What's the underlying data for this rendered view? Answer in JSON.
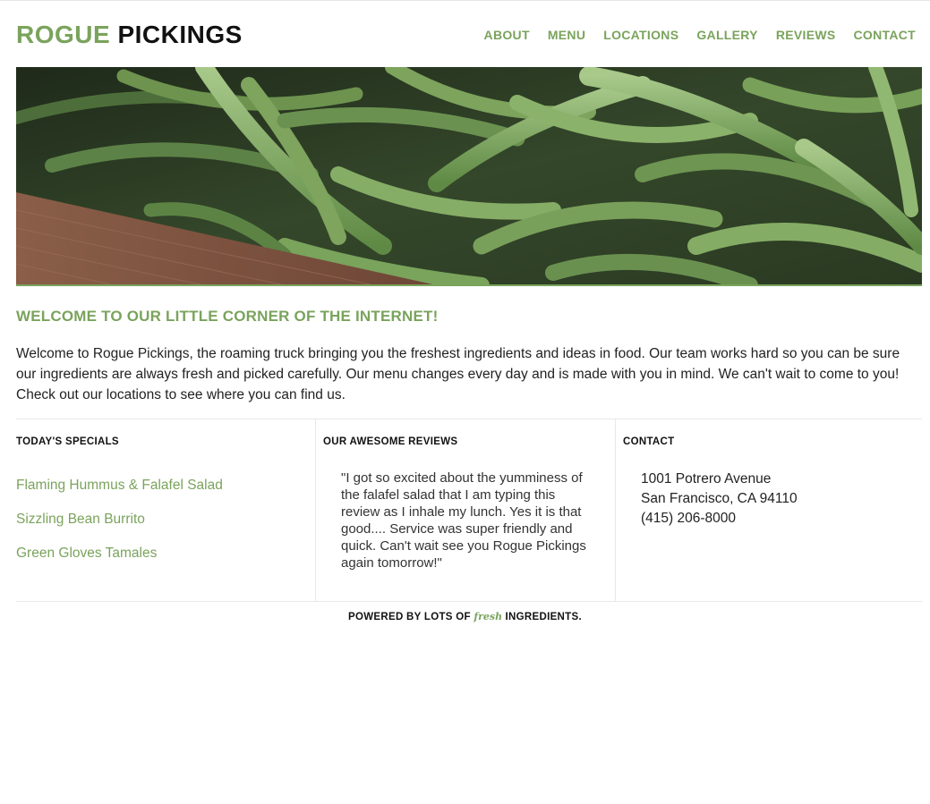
{
  "brand": {
    "first": "ROGUE",
    "second": "PICKINGS"
  },
  "nav": [
    "ABOUT",
    "MENU",
    "LOCATIONS",
    "GALLERY",
    "REVIEWS",
    "CONTACT"
  ],
  "welcome": {
    "title": "WELCOME TO OUR LITTLE CORNER OF THE INTERNET!",
    "text": "Welcome to Rogue Pickings, the roaming truck bringing you the freshest ingredients and ideas in food. Our team works hard so you can be sure our ingredients are always fresh and picked carefully. Our menu changes every day and is made with you in mind. We can't wait to come to you! Check out our locations to see where you can find us."
  },
  "specials": {
    "title": "TODAY'S SPECIALS",
    "items": [
      "Flaming Hummus & Falafel Salad",
      "Sizzling Bean Burrito",
      "Green Gloves Tamales"
    ]
  },
  "reviews": {
    "title": "OUR AWESOME REVIEWS",
    "text": "\"I got so excited about the yumminess of the falafel salad that I am typing this review as I inhale my lunch. Yes it is that good.... Service was super friendly and quick. Can't wait see you Rogue Pickings again tomorrow!\""
  },
  "contact": {
    "title": "CONTACT",
    "street": "1001 Potrero Avenue",
    "city": "San Francisco, CA 94110",
    "phone": "(415) 206-8000"
  },
  "footer": {
    "before": "POWERED BY LOTS OF ",
    "fresh": "fresh",
    "after": " INGREDIENTS."
  },
  "hero": {
    "image": "green-beans-photo"
  },
  "colors": {
    "accent": "#7aa35c",
    "text": "#222222",
    "divider": "#e8e8e8"
  }
}
